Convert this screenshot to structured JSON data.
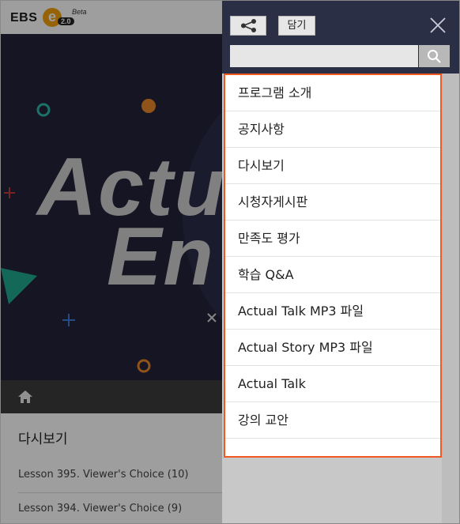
{
  "header": {
    "logo_text": "EBS",
    "logo_badge": "2.0",
    "logo_beta": "Beta"
  },
  "hero": {
    "title_line1": "Actu",
    "title_line2": "En"
  },
  "page": {
    "section_title": "다시보기",
    "lessons": [
      "Lesson 395. Viewer's Choice (10)",
      "Lesson 394. Viewer's Choice (9)"
    ]
  },
  "drawer": {
    "save_label": "담기",
    "search_placeholder": "",
    "menu_items": [
      "프로그램 소개",
      "공지사항",
      "다시보기",
      "시청자게시판",
      "만족도 평가",
      "학습 Q&A",
      "Actual Talk MP3 파일",
      "Actual Story MP3 파일",
      "Actual Talk",
      "강의 교안"
    ]
  },
  "colors": {
    "accent_border": "#f05a22",
    "drawer_header": "#2a2f45"
  }
}
